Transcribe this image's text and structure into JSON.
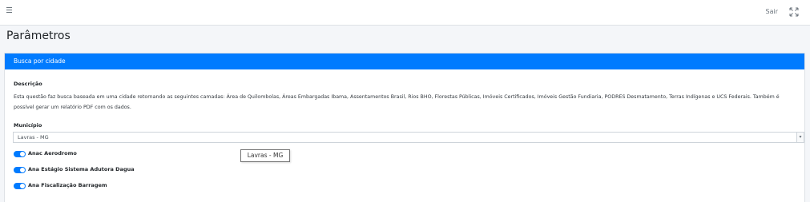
{
  "topbar": {
    "menu_icon": "hamburger-menu-icon",
    "logout_label": "Sair",
    "fullscreen_icon": "expand-arrows-icon"
  },
  "page": {
    "title": "Parâmetros"
  },
  "card": {
    "header_title": "Busca por cidade",
    "description_label": "Descrição",
    "description_text": "Esta questão faz busca baseada em uma cidade retornando as seguintes camadas: Área de Quilombolas, Áreas Embargadas Ibama, Assentamentos Brasil, Rios BHO, Florestas Públicas, Imóveis Certificados, Imóveis Gestão Fundiaria, PODRES Desmatamento, Terras Indígenas e UCS Federais. Também é possível gerar um relatório PDF com os dados.",
    "municipio_label": "Município",
    "municipio_value": "Lavras - MG",
    "toggles": [
      {
        "label": "Anac Aerodromo",
        "checked": true
      },
      {
        "label": "Ana Estágio Sistema Adutora Dagua",
        "checked": true
      },
      {
        "label": "Ana Fiscalização Barragem",
        "checked": true
      }
    ],
    "accent_color": "#007bff"
  },
  "tooltip": {
    "text": "Lavras - MG"
  }
}
